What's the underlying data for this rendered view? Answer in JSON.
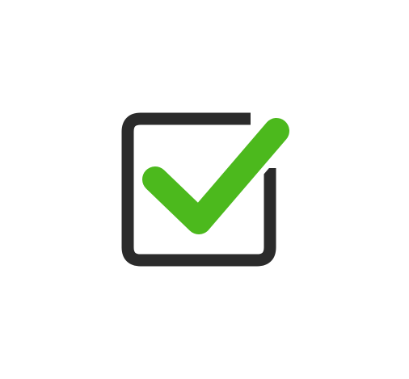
{
  "icon": {
    "name": "checkbox-checked-icon",
    "checked": true,
    "colors": {
      "background": "#ffffff",
      "box_outline": "#2b2b2b",
      "checkmark": "#4cb91d"
    }
  }
}
